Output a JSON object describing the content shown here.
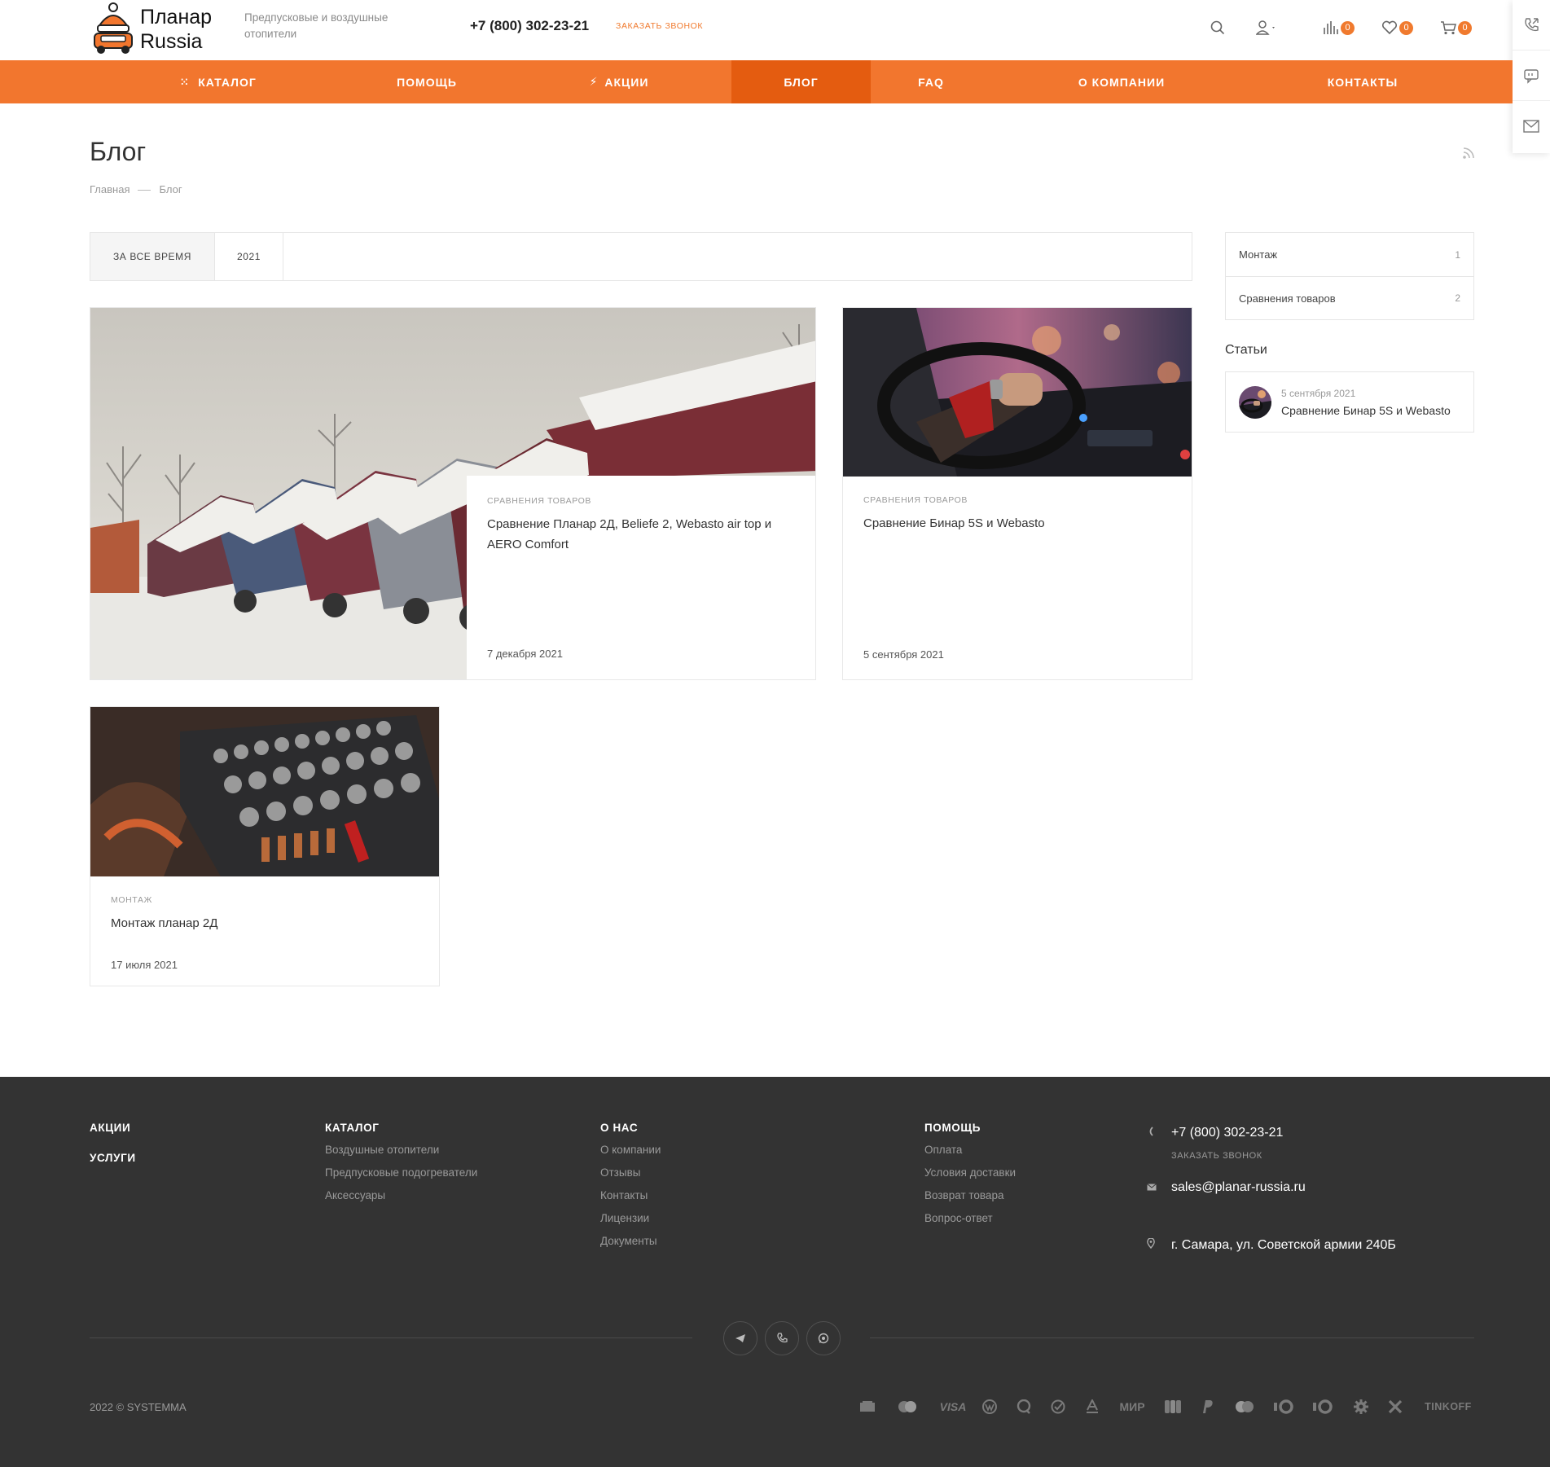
{
  "header": {
    "logo_line1": "Планар",
    "logo_line2": "Russia",
    "tagline": "Предпусковые и воздушные отопители",
    "phone": "+7 (800) 302-23-21",
    "callback": "ЗАКАЗАТЬ ЗВОНОК",
    "compare_count": "0",
    "favorites_count": "0",
    "cart_count": "0"
  },
  "nav": {
    "items": [
      "КАТАЛОГ",
      "ПОМОЩЬ",
      "АКЦИИ",
      "БЛОГ",
      "FAQ",
      "О КОМПАНИИ",
      "КОНТАКТЫ"
    ],
    "active": "БЛОГ"
  },
  "page": {
    "title": "Блог",
    "breadcrumb": [
      "Главная",
      "Блог"
    ]
  },
  "filter": [
    "ЗА ВСЕ ВРЕМЯ",
    "2021"
  ],
  "articles": [
    {
      "category": "СРАВНЕНИЯ ТОВАРОВ",
      "title": "Сравнение Планар 2Д, Beliefe 2, Webasto air top и AERO Comfort",
      "date": "7 декабря 2021"
    },
    {
      "category": "СРАВНЕНИЯ ТОВАРОВ",
      "title": "Сравнение Бинар 5S и Webasto",
      "date": "5 сентября 2021"
    },
    {
      "category": "МОНТАЖ",
      "title": "Монтаж планар 2Д",
      "date": "17 июля 2021"
    }
  ],
  "sidebar": {
    "tags": [
      {
        "name": "Монтаж",
        "count": "1"
      },
      {
        "name": "Сравнения товаров",
        "count": "2"
      }
    ],
    "articles_heading": "Статьи",
    "article": {
      "date": "5 сентября 2021",
      "title": "Сравнение Бинар 5S и Webasto"
    }
  },
  "footer": {
    "col1": [
      "АКЦИИ",
      "УСЛУГИ"
    ],
    "catalog": {
      "head": "КАТАЛОГ",
      "links": [
        "Воздушные отопители",
        "Предпусковые подогреватели",
        "Аксессуары"
      ]
    },
    "about": {
      "head": "О НАС",
      "links": [
        "О компании",
        "Отзывы",
        "Контакты",
        "Лицензии",
        "Документы"
      ]
    },
    "help": {
      "head": "ПОМОЩЬ",
      "links": [
        "Оплата",
        "Условия доставки",
        "Возврат товара",
        "Вопрос-ответ"
      ]
    },
    "phone": "+7 (800) 302-23-21",
    "callback": "ЗАКАЗАТЬ ЗВОНОК",
    "email": "sales@planar-russia.ru",
    "address": "г. Самара, ул. Советской армии 240Б",
    "copyright": "2022 © SYSTEMMA",
    "payments": [
      "VISA",
      "МИР",
      "TINKOFF"
    ]
  },
  "colors": {
    "accent": "#f2762e",
    "accent_active": "#e45c10",
    "footer_bg": "#333333"
  },
  "icons": [
    "search-icon",
    "user-icon",
    "compare-icon",
    "heart-icon",
    "cart-icon",
    "callback-icon",
    "chat-icon",
    "mail-icon",
    "rss-icon",
    "telegram-icon",
    "viber-icon",
    "whatsapp-icon",
    "phone-icon",
    "location-icon"
  ]
}
